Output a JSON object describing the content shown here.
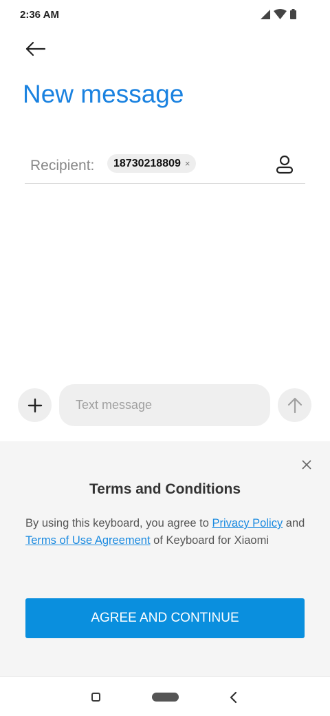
{
  "status_bar": {
    "time": "2:36 AM",
    "icons": [
      "signal-icon",
      "wifi-icon",
      "battery-icon"
    ]
  },
  "header": {
    "back_icon": "arrow-left-icon",
    "title": "New message",
    "title_color": "#1a82e0"
  },
  "recipient": {
    "label": "Recipient:",
    "chips": [
      "18730218809"
    ],
    "chip_remove_symbol": "×",
    "contact_icon": "contact-person-icon"
  },
  "composer": {
    "add_icon": "plus-icon",
    "input_placeholder": "Text message",
    "input_value": "",
    "send_icon": "arrow-up-icon"
  },
  "terms": {
    "title": "Terms and Conditions",
    "body_prefix": "By using this keyboard, you agree to ",
    "privacy_link": "Privacy Policy",
    "body_mid": " and ",
    "terms_link": "Terms of Use Agreement",
    "body_suffix": " of Keyboard for Xiaomi",
    "button_label": "AGREE AND CONTINUE",
    "button_color": "#0a8fde",
    "link_color": "#1a8ae0",
    "close_icon": "close-icon"
  },
  "nav_bar": {
    "items": [
      "recents-icon",
      "home-pill-icon",
      "back-chevron-icon"
    ]
  }
}
